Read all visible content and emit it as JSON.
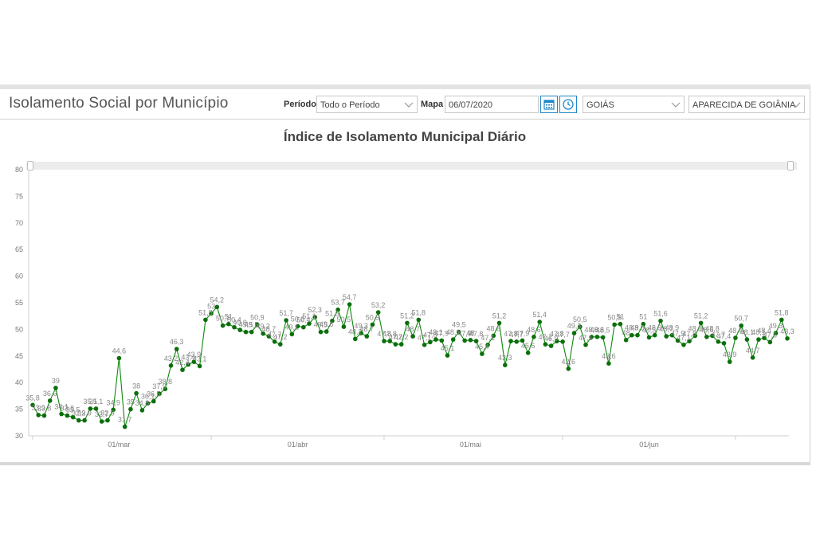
{
  "header": {
    "title": "Isolamento Social por Município",
    "periodo_label": "Período",
    "periodo_value": "Todo o Período",
    "mapa_label": "Mapa",
    "mapa_value": "06/07/2020",
    "estado_value": "GOIÁS",
    "municipio_value": "APARECIDA DE GOIÂNIA"
  },
  "colors": {
    "series": "#0a8a0a",
    "marker": "#0b6e0b",
    "accent": "#1e87c8"
  },
  "icons": {
    "calendar": "calendar-icon",
    "clock": "clock-icon"
  },
  "chart_data": {
    "type": "line",
    "title": "Índice de Isolamento Municipal Diário",
    "xlabel": "",
    "ylabel": "",
    "ylim": [
      30,
      80
    ],
    "yticks": [
      30,
      35,
      40,
      45,
      50,
      55,
      60,
      65,
      70,
      75,
      80
    ],
    "x_start": "2020-02-15",
    "xtick_labels": [
      "01/mar",
      "01/abr",
      "01/mai",
      "01/jun"
    ],
    "xtick_dates": [
      "2020-03-01",
      "2020-04-01",
      "2020-05-01",
      "2020-06-01"
    ],
    "grid": false,
    "series": [
      {
        "name": "",
        "values": [
          35.8,
          33.9,
          33.8,
          36.6,
          39,
          34.1,
          33.8,
          33.5,
          32.9,
          32.9,
          35.1,
          35.1,
          32.7,
          32.9,
          34.9,
          44.6,
          31.7,
          35,
          38,
          34.8,
          36.1,
          36.5,
          37.9,
          38.8,
          43.2,
          46.3,
          42.4,
          43.4,
          43.9,
          43.1,
          51.8,
          53,
          54.2,
          50.7,
          51,
          50.4,
          49.9,
          49.5,
          49.5,
          50.9,
          49.2,
          48.7,
          47.7,
          47.2,
          51.7,
          49.1,
          50.6,
          50.4,
          51.1,
          52.3,
          49.5,
          49.6,
          51.6,
          53.7,
          50.5,
          54.7,
          48.2,
          49.3,
          48.7,
          50.9,
          53.2,
          47.8,
          47.8,
          47.2,
          47.2,
          51.2,
          48.7,
          51.8,
          47.1,
          47.6,
          48.1,
          47.9,
          45.1,
          48.1,
          49.5,
          47.9,
          48,
          47.8,
          45.4,
          47.1,
          48.8,
          51.2,
          43.3,
          47.8,
          47.7,
          47.9,
          45.6,
          48.6,
          51.4,
          47.2,
          46.9,
          47.8,
          47.7,
          42.6,
          49.3,
          50.5,
          47.1,
          48.6,
          48.6,
          48.5,
          43.6,
          50.9,
          51,
          48,
          48.9,
          48.9,
          51,
          48.5,
          48.9,
          51.6,
          48.7,
          48.9,
          47.9,
          47.1,
          47.8,
          48.8,
          51.2,
          48.6,
          48.8,
          47.7,
          47.4,
          43.9,
          48.4,
          50.7,
          48.1,
          44.7,
          48.1,
          48.4,
          47.6,
          49.3,
          51.8,
          48.3
        ]
      }
    ],
    "data_labels": [
      35.8,
      33.9,
      33.8,
      36.6,
      39,
      34.1,
      33.8,
      33.5,
      32.9,
      32.9,
      35.1,
      35.1,
      32.7,
      32.9,
      34.9,
      44.6,
      31.7,
      35,
      38,
      34.8,
      36.1,
      36.5,
      37.9,
      38.8,
      43.2,
      46.3,
      42.4,
      43.4,
      43.9,
      43.1,
      51.8,
      53,
      54.2,
      50.7,
      51,
      50.4,
      49.9,
      49.5,
      49.5,
      50.9,
      49.2,
      48.7,
      47.7,
      47.2,
      51.7,
      49.1,
      50.6,
      50.4,
      51.1,
      52.3,
      49.5,
      49.6,
      51.6,
      53.7,
      50.5,
      54.7,
      48.2,
      49.3,
      48.7,
      50.9,
      53.2,
      47.8,
      47.8,
      47.2,
      47.2,
      51.2,
      48.7,
      51.8,
      47.1,
      47.6,
      48.1,
      47.9,
      45.1,
      48.1,
      49.5,
      47.9,
      48,
      47.8,
      45.4,
      47.1,
      48.8,
      51.2,
      43.3,
      47.8,
      47.7,
      47.9,
      45.6,
      48.6,
      51.4,
      47.2,
      46.9,
      47.8,
      47.7,
      42.6,
      49.3,
      50.5,
      47.1,
      48.6,
      48.6,
      48.5,
      43.6,
      50.9,
      51,
      48,
      48.9,
      48.9,
      51,
      48.5,
      48.9,
      51.6,
      48.7,
      48.9,
      47.9,
      47.1,
      47.8,
      48.8,
      51.2,
      48.6,
      48.8,
      47.7,
      47.4,
      43.9,
      48.4,
      50.7,
      48.1,
      44.7,
      48.1,
      48.4,
      47.6,
      49.3,
      51.8,
      48.3
    ]
  }
}
